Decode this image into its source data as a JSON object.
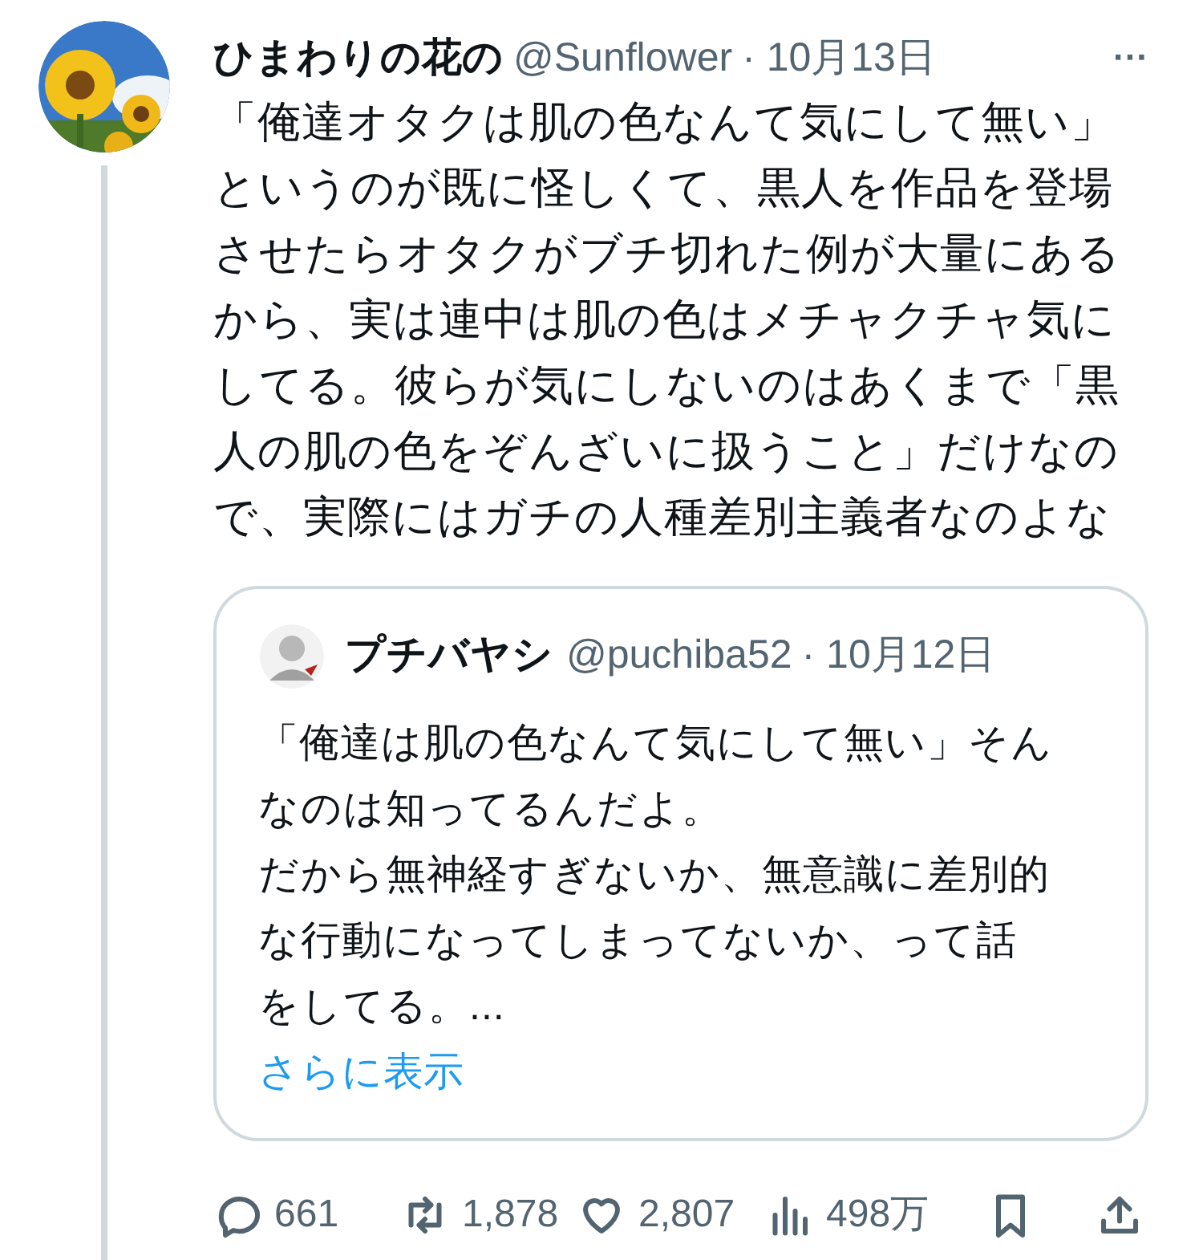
{
  "tweet": {
    "name": "ひまわりの花の",
    "handle": "@Sunflower",
    "date": "· 10月13日",
    "more": "···",
    "text_lines": [
      "「俺達オタクは肌の色なんて気にして無い」",
      "というのが既に怪しくて、黒人を作品を登場",
      "させたらオタクがブチ切れた例が大量にある",
      "から、実は連中は肌の色はメチャクチャ気に",
      "してる。彼らが気にしないのはあくまで「黒",
      "人の肌の色をぞんざいに扱うこと」だけなの",
      "で、実際にはガチの人種差別主義者なのよな"
    ],
    "quote": {
      "name": "プチバヤシ",
      "handle": "@puchiba52",
      "date": "· 10月12日",
      "text_lines": [
        "「俺達は肌の色なんて気にして無い」そん",
        "なのは知ってるんだよ。",
        "だから無神経すぎないか、無意識に差別的",
        "な行動になってしまってないか、って話",
        "をしてる。..."
      ],
      "show_more": "さらに表示"
    },
    "actions": [
      {
        "kind": "reply",
        "count": "661"
      },
      {
        "kind": "repost",
        "count": "1,878"
      },
      {
        "kind": "like",
        "count": "2,807"
      },
      {
        "kind": "views",
        "count": "498万"
      },
      {
        "kind": "bookmark"
      },
      {
        "kind": "share"
      }
    ]
  }
}
